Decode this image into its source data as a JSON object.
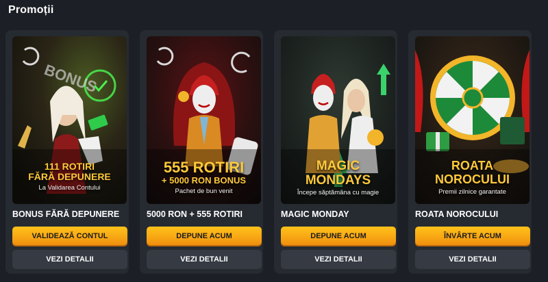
{
  "section_title": "Promoții",
  "promotions": [
    {
      "art_headline_1": "111 ROTIRI",
      "art_headline_2": "FĂRĂ DEPUNERE",
      "art_subline": "La Validarea Contului",
      "art_badge": "BONUS",
      "title": "BONUS FĂRĂ DEPUNERE",
      "primary_label": "VALIDEAZĂ CONTUL",
      "secondary_label": "VEZI DETALII"
    },
    {
      "art_headline_1": "555 ROTIRI",
      "art_headline_2": "+ 5000 RON BONUS",
      "art_subline": "Pachet de bun venit",
      "title": "5000 RON + 555 ROTIRI",
      "primary_label": "DEPUNE ACUM",
      "secondary_label": "VEZI DETALII"
    },
    {
      "art_headline_1": "MAGIC",
      "art_headline_2": "MONDAYS",
      "art_subline": "Începe săptămâna cu magie",
      "title": "MAGIC MONDAY",
      "primary_label": "DEPUNE ACUM",
      "secondary_label": "VEZI DETALII"
    },
    {
      "art_headline_1": "ROATA",
      "art_headline_2": "NOROCULUI",
      "art_subline": "Premii zilnice garantate",
      "title": "ROATA NOROCULUI",
      "primary_label": "ÎNVÂRTE ACUM",
      "secondary_label": "VEZI DETALII"
    }
  ],
  "colors": {
    "page_background": "#1c1f25",
    "card_background": "#262a31",
    "primary_button": "#f7a513",
    "secondary_button": "#353a43",
    "headline_text": "#ffc93a"
  }
}
